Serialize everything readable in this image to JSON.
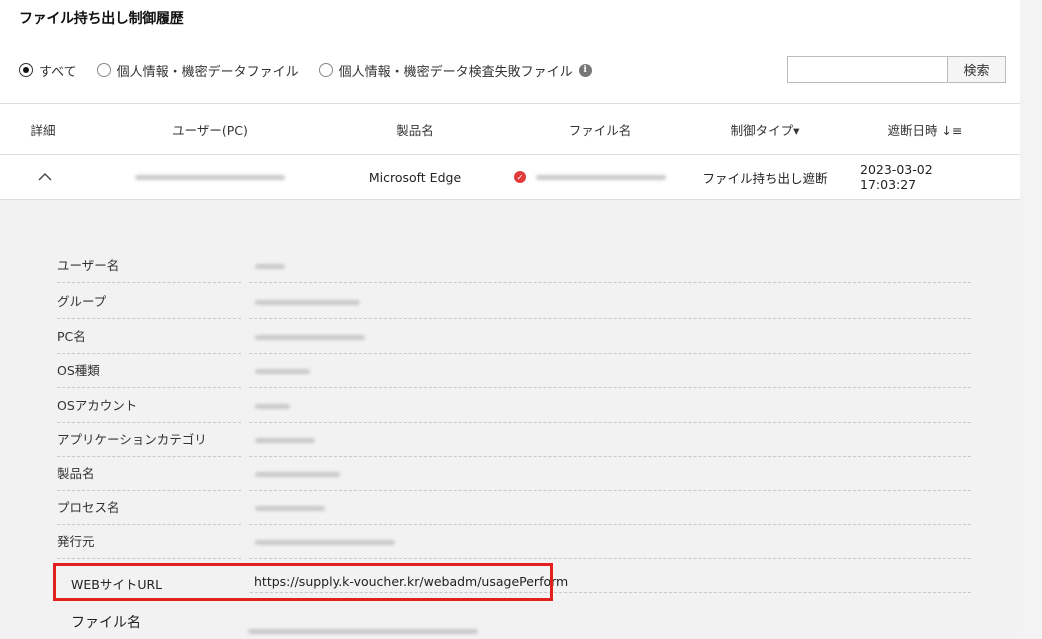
{
  "page": {
    "title": "ファイル持ち出し制御履歴"
  },
  "filters": {
    "options": [
      {
        "label": "すべて",
        "checked": true
      },
      {
        "label": "個人情報・機密データファイル",
        "checked": false
      },
      {
        "label": "個人情報・機密データ検査失敗ファイル",
        "checked": false
      }
    ],
    "info_icon": "info-icon",
    "search_placeholder": "",
    "search_button": "検索"
  },
  "table": {
    "headers": {
      "detail": "詳細",
      "user": "ユーザー(PC)",
      "product": "製品名",
      "filename": "ファイル名",
      "control_type": "制御タイプ▾",
      "blocked_time": "遮断日時 ↓≡"
    },
    "row": {
      "expand_icon": "chevron-up-icon",
      "product": "Microsoft Edge",
      "control_type": "ファイル持ち出し遮断",
      "blocked_time": "2023-03-02 17:03:27"
    }
  },
  "detail": {
    "labels": [
      "ユーザー名",
      "グループ",
      "PC名",
      "OS種類",
      "OSアカウント",
      "アプリケーションカテゴリ",
      "製品名",
      "プロセス名",
      "発行元"
    ],
    "url_label": "WEBサイトURL",
    "url_value": "https://supply.k-voucher.kr/webadm/usagePerform",
    "file_label": "ファイル名"
  },
  "colors": {
    "highlight": "#e41f1f",
    "status_icon": "#e23b3b",
    "panel": "#f2f2f2"
  }
}
